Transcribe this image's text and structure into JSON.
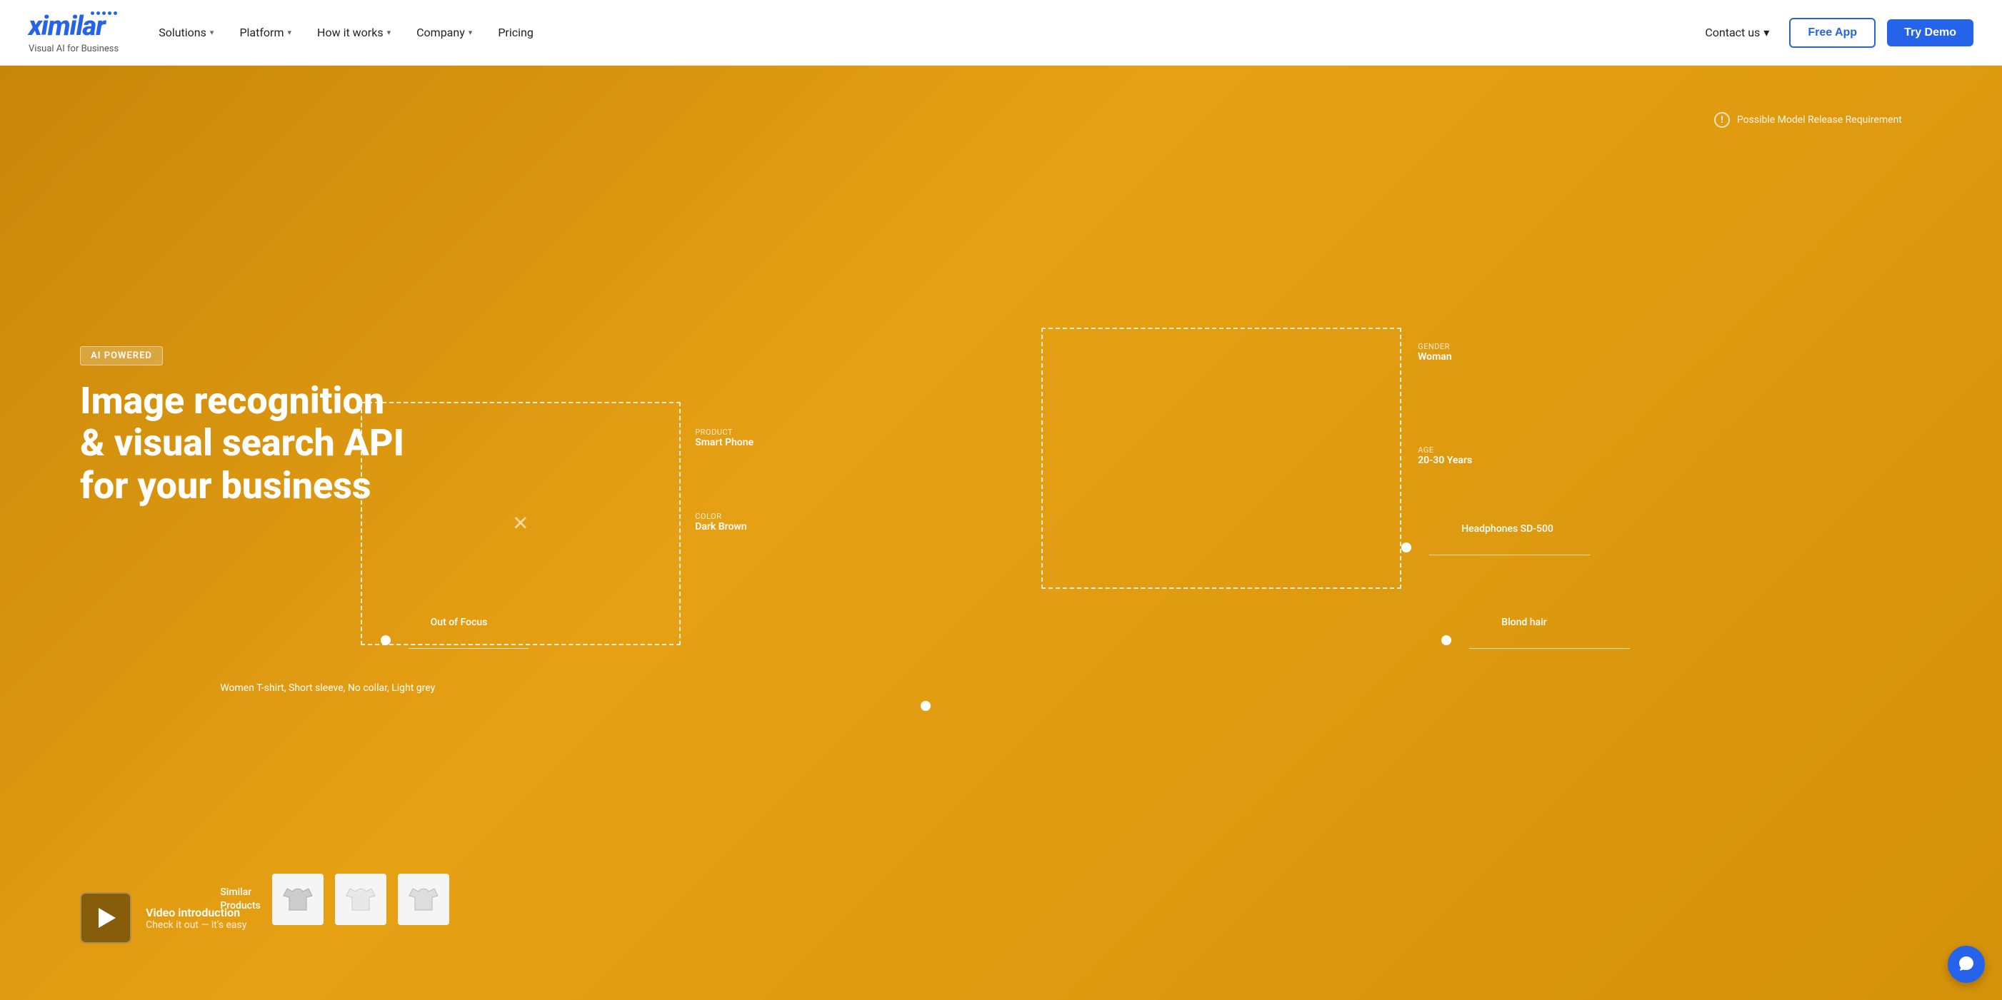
{
  "brand": {
    "name": "ximilar",
    "tagline": "Visual AI for Business"
  },
  "navbar": {
    "solutions_label": "Solutions",
    "platform_label": "Platform",
    "how_it_works_label": "How it works",
    "company_label": "Company",
    "pricing_label": "Pricing",
    "contact_us_label": "Contact us",
    "free_app_label": "Free App",
    "try_demo_label": "Try Demo"
  },
  "hero": {
    "badge": "AI POWERED",
    "title_line1": "Image recognition",
    "title_line2": "& visual search API",
    "title_line3": "for your business",
    "model_notice": "Possible Model Release Requirement",
    "annotations": {
      "phone_product": "Smart Phone",
      "phone_product_label": "PRODUCT",
      "phone_color": "Dark Brown",
      "phone_color_label": "COLOR",
      "gender_label": "GENDER",
      "gender_value": "Woman",
      "age_label": "AGE",
      "age_value": "20-30 Years",
      "headphones": "Headphones SD-500",
      "hair": "Blond hair",
      "out_of_focus": "Out of Focus",
      "tshirt": "Women T-shirt, Short sleeve, No collar, Light grey"
    },
    "similar_products_label": "Similar\nProducts",
    "video_title": "Video introduction",
    "video_sub": "Check it out — it's easy"
  }
}
